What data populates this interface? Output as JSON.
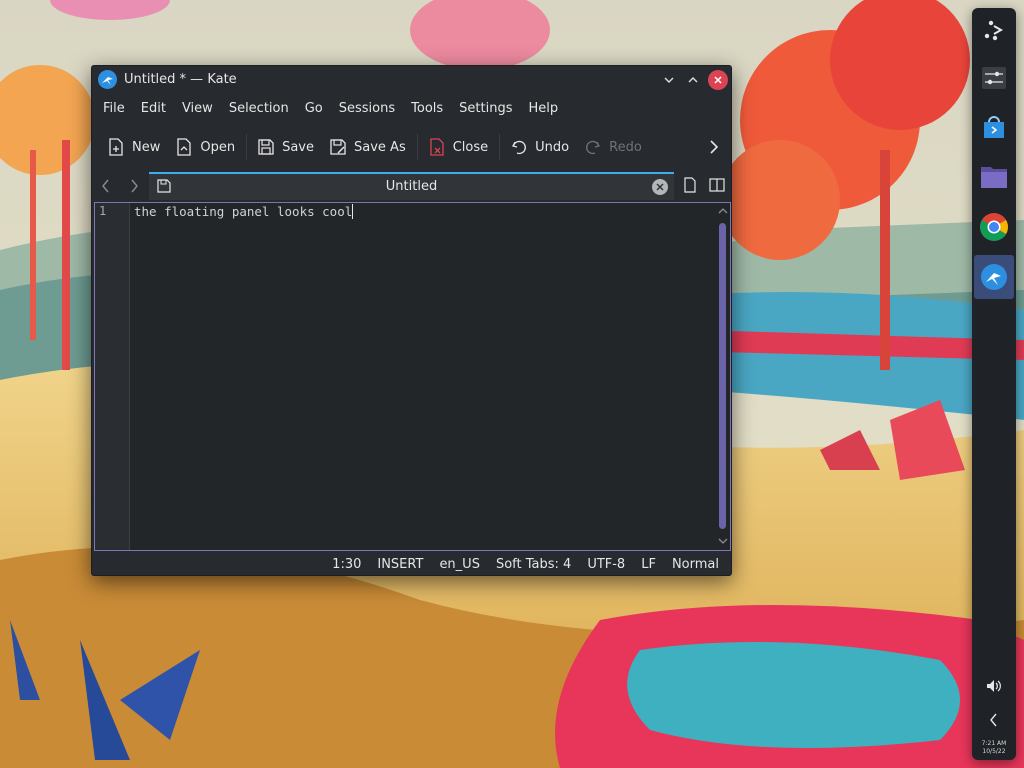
{
  "window": {
    "title": "Untitled * — Kate"
  },
  "menubar": {
    "items": [
      "File",
      "Edit",
      "View",
      "Selection",
      "Go",
      "Sessions",
      "Tools",
      "Settings",
      "Help"
    ]
  },
  "toolbar": {
    "new_label": "New",
    "open_label": "Open",
    "save_label": "Save",
    "save_as_label": "Save As",
    "close_label": "Close",
    "undo_label": "Undo",
    "redo_label": "Redo"
  },
  "tabs": {
    "active_label": "Untitled"
  },
  "editor": {
    "line_numbers": [
      "1"
    ],
    "lines": [
      "the floating panel looks cool"
    ]
  },
  "statusbar": {
    "cursor": "1:30",
    "mode": "INSERT",
    "language": "en_US",
    "indent": "Soft Tabs: 4",
    "encoding": "UTF-8",
    "eol": "LF",
    "highlight": "Normal"
  },
  "panel": {
    "time": "7:21 AM",
    "date": "10/5/22"
  },
  "colors": {
    "accent": "#3daee9",
    "selection_border": "#7e75b6",
    "close_red": "#da4453"
  }
}
